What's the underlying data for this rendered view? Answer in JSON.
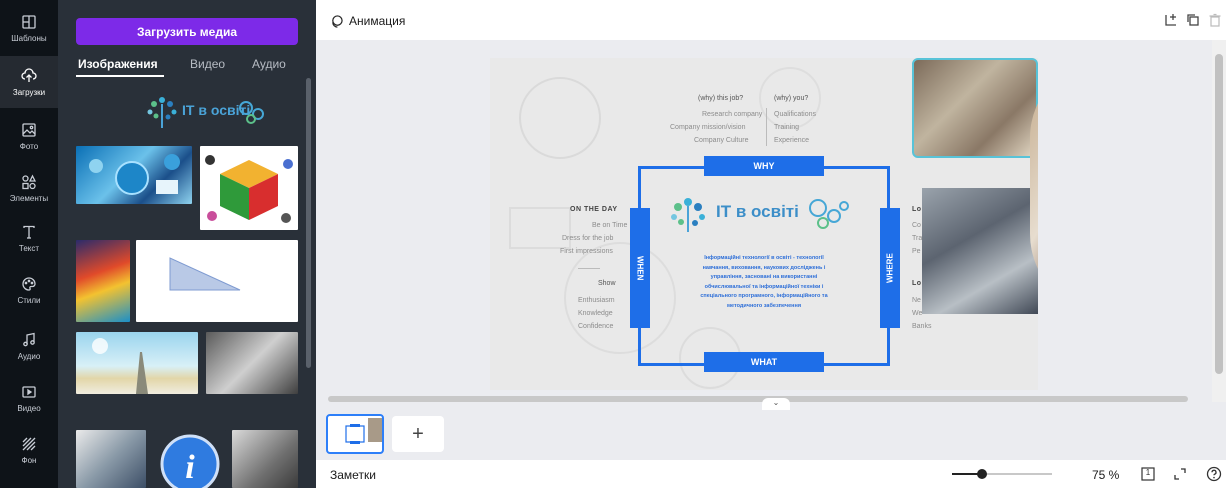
{
  "rail": {
    "items": [
      {
        "label": "Шаблоны",
        "icon": "templates-icon"
      },
      {
        "label": "Загрузки",
        "icon": "uploads-icon"
      },
      {
        "label": "Фото",
        "icon": "photo-icon"
      },
      {
        "label": "Элементы",
        "icon": "elements-icon"
      },
      {
        "label": "Текст",
        "icon": "text-icon"
      },
      {
        "label": "Стили",
        "icon": "styles-icon"
      },
      {
        "label": "Аудио",
        "icon": "audio-icon"
      },
      {
        "label": "Видео",
        "icon": "video-icon"
      },
      {
        "label": "Фон",
        "icon": "background-icon"
      }
    ],
    "active": "Загрузки"
  },
  "panel": {
    "upload_label": "Загрузить медиа",
    "tabs": [
      "Изображения",
      "Видео",
      "Аудио"
    ],
    "active_tab": "Изображения",
    "logo_text": "IT в освіті"
  },
  "topbar": {
    "animation_label": "Анимация"
  },
  "design": {
    "why_label": "WHY",
    "what_label": "WHAT",
    "when_label": "WHEN",
    "where_label": "WHERE",
    "logo_text": "IT в освіті",
    "why_col1_head": "(why) this job?",
    "why_col1": [
      "Research company",
      "Company mission/vision",
      "Company Culture"
    ],
    "why_col2_head": "(why) you?",
    "why_col2": [
      "Qualifications",
      "Training",
      "Experience"
    ],
    "onday_head": "ON THE DAY",
    "onday": [
      "Be on Time",
      "Dress for the job",
      "First impressions"
    ],
    "show_head": "Show",
    "show": [
      "Enthusiasm",
      "Knowledge",
      "Confidence"
    ],
    "right_head1": "Lo",
    "right_rows1": [
      "Co",
      "Tra",
      "Pe"
    ],
    "right_head2": "Lo",
    "right_rows2": [
      "Ne",
      "We",
      "Banks"
    ],
    "center_text": "Інформаційні технології в освіті - технології навчання, виховання, наукових досліджень і управління, засновані на використанні обчислювальної та інформаційної техніки і спеціального програмного, інформаційного та методичного забезпечення"
  },
  "pages": {
    "add_label": "+"
  },
  "footer": {
    "notes_label": "Заметки",
    "zoom": "75 %",
    "zoom_fraction": 0.3,
    "page_number": "1"
  }
}
